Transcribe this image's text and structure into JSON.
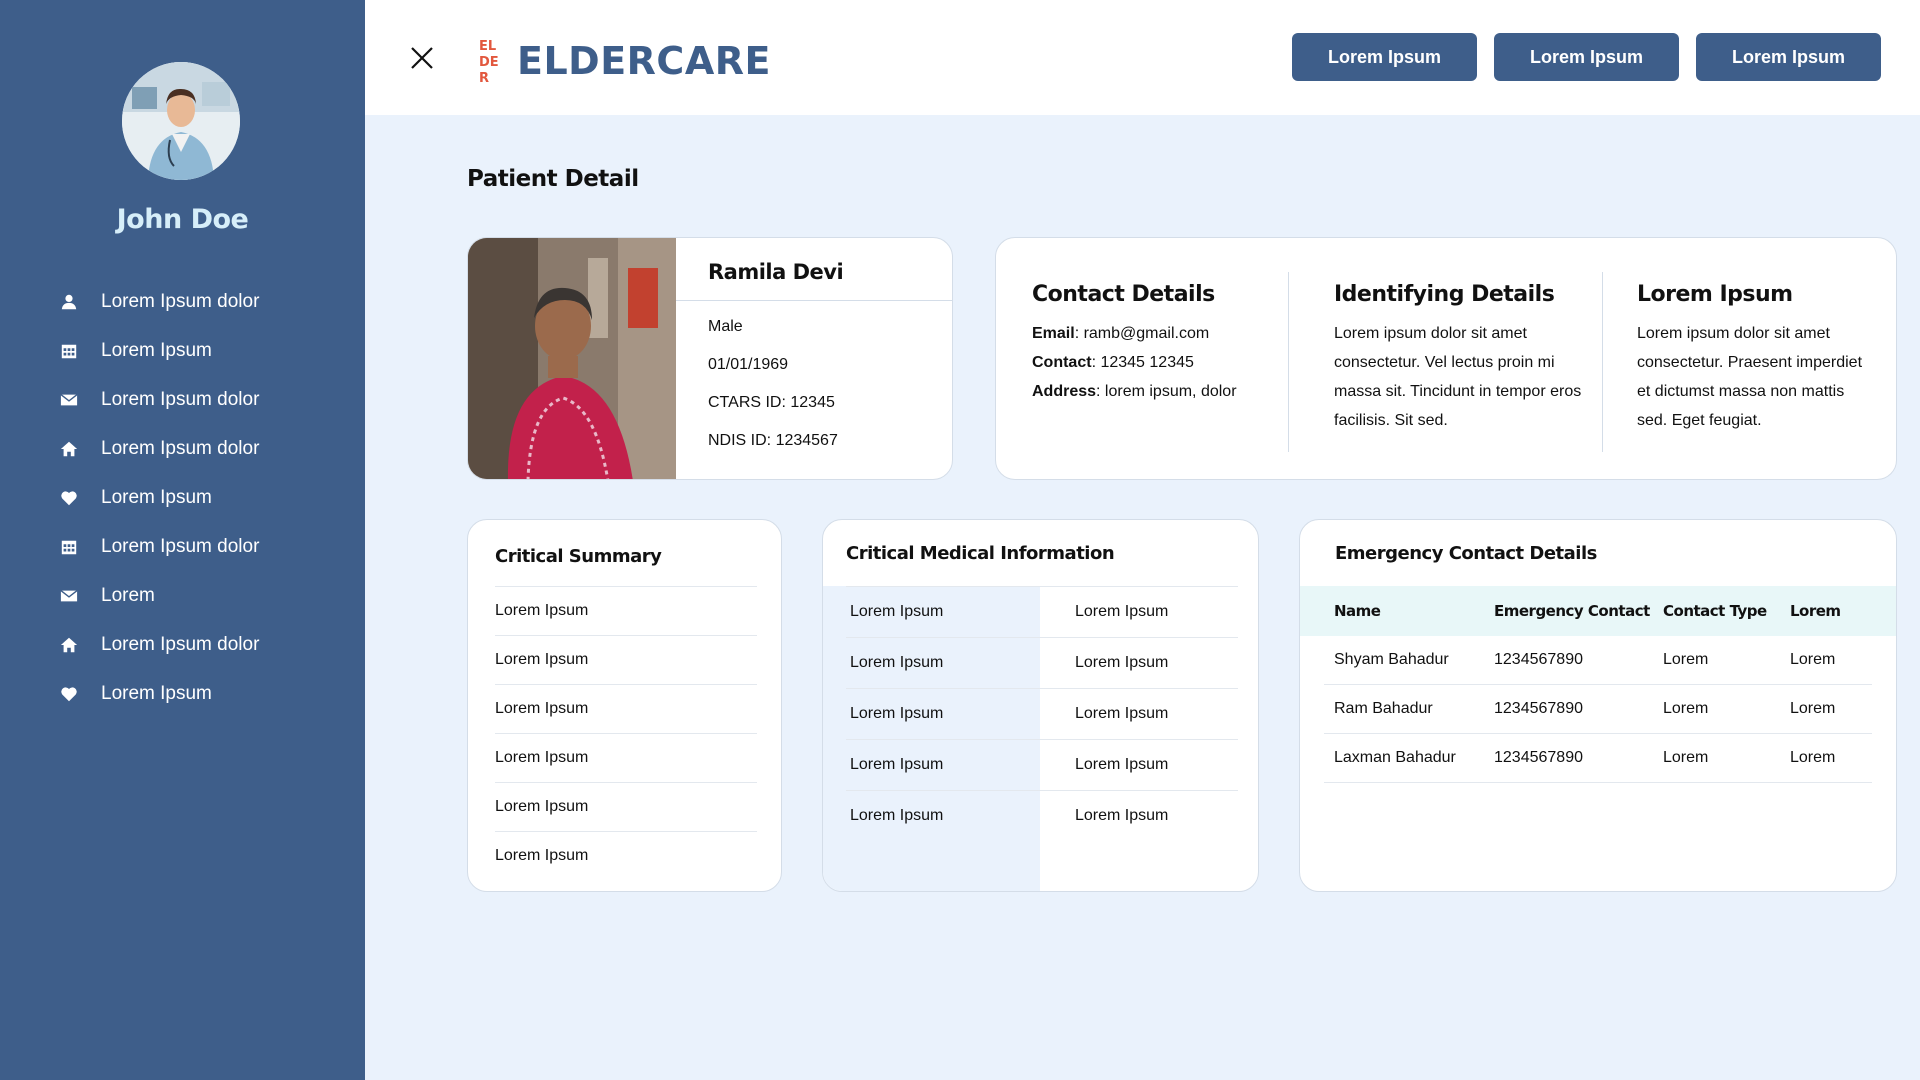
{
  "sidebar": {
    "user_name": "John Doe",
    "items": [
      {
        "label": "Lorem Ipsum dolor",
        "icon": "user-icon"
      },
      {
        "label": "Lorem Ipsum",
        "icon": "calendar-icon"
      },
      {
        "label": "Lorem Ipsum dolor",
        "icon": "mail-icon"
      },
      {
        "label": "Lorem Ipsum dolor",
        "icon": "home-icon"
      },
      {
        "label": "Lorem Ipsum",
        "icon": "heart-icon"
      },
      {
        "label": "Lorem Ipsum dolor",
        "icon": "calendar-icon"
      },
      {
        "label": "Lorem",
        "icon": "mail-icon"
      },
      {
        "label": "Lorem Ipsum dolor",
        "icon": "home-icon"
      },
      {
        "label": "Lorem Ipsum",
        "icon": "heart-icon"
      }
    ]
  },
  "header": {
    "logo_text": "ELDERCARE",
    "logo_mark_text": "EL DE R",
    "buttons": [
      "Lorem Ipsum",
      "Lorem Ipsum",
      "Lorem Ipsum"
    ]
  },
  "page_title": "Patient Detail",
  "patient": {
    "name": "Ramila Devi",
    "gender": "Male",
    "dob": "01/01/1969",
    "ctars": "CTARS ID: 12345",
    "ndis": "NDIS ID: 1234567"
  },
  "contact": {
    "title": "Contact Details",
    "email_label": "Email",
    "email": ": ramb@gmail.com",
    "contact_label": "Contact",
    "contact": ": 12345 12345",
    "address_label": "Address",
    "address": ": lorem ipsum, dolor"
  },
  "identifying": {
    "title": "Identifying Details",
    "text": "Lorem ipsum dolor sit amet consectetur. Vel lectus proin mi massa sit. Tincidunt in tempor eros facilisis. Sit sed."
  },
  "lorem_col": {
    "title": "Lorem Ipsum",
    "text": "Lorem ipsum dolor sit amet consectetur. Praesent imperdiet et dictumst massa non mattis sed. Eget feugiat."
  },
  "critical_summary": {
    "title": "Critical Summary",
    "items": [
      "Lorem Ipsum",
      "Lorem Ipsum",
      "Lorem Ipsum",
      "Lorem Ipsum",
      "Lorem Ipsum",
      "Lorem Ipsum"
    ]
  },
  "critical_medical": {
    "title": "Critical Medical Information",
    "rows": [
      [
        "Lorem Ipsum",
        "Lorem Ipsum"
      ],
      [
        "Lorem Ipsum",
        "Lorem Ipsum"
      ],
      [
        "Lorem Ipsum",
        "Lorem Ipsum"
      ],
      [
        "Lorem Ipsum",
        "Lorem Ipsum"
      ],
      [
        "Lorem Ipsum",
        "Lorem Ipsum"
      ]
    ]
  },
  "emergency": {
    "title": "Emergency Contact Details",
    "columns": [
      "Name",
      "Emergency Contact",
      "Contact Type",
      "Lorem"
    ],
    "rows": [
      [
        "Shyam Bahadur",
        "1234567890",
        "Lorem",
        "Lorem"
      ],
      [
        "Ram Bahadur",
        "1234567890",
        "Lorem",
        "Lorem"
      ],
      [
        "Laxman Bahadur",
        "1234567890",
        "Lorem",
        "Lorem"
      ]
    ]
  },
  "colors": {
    "sidebar": "#3E5E8A",
    "background": "#EAF2FC",
    "accent_name": "#D6EEF9",
    "logo_mark": "#E2583E"
  }
}
